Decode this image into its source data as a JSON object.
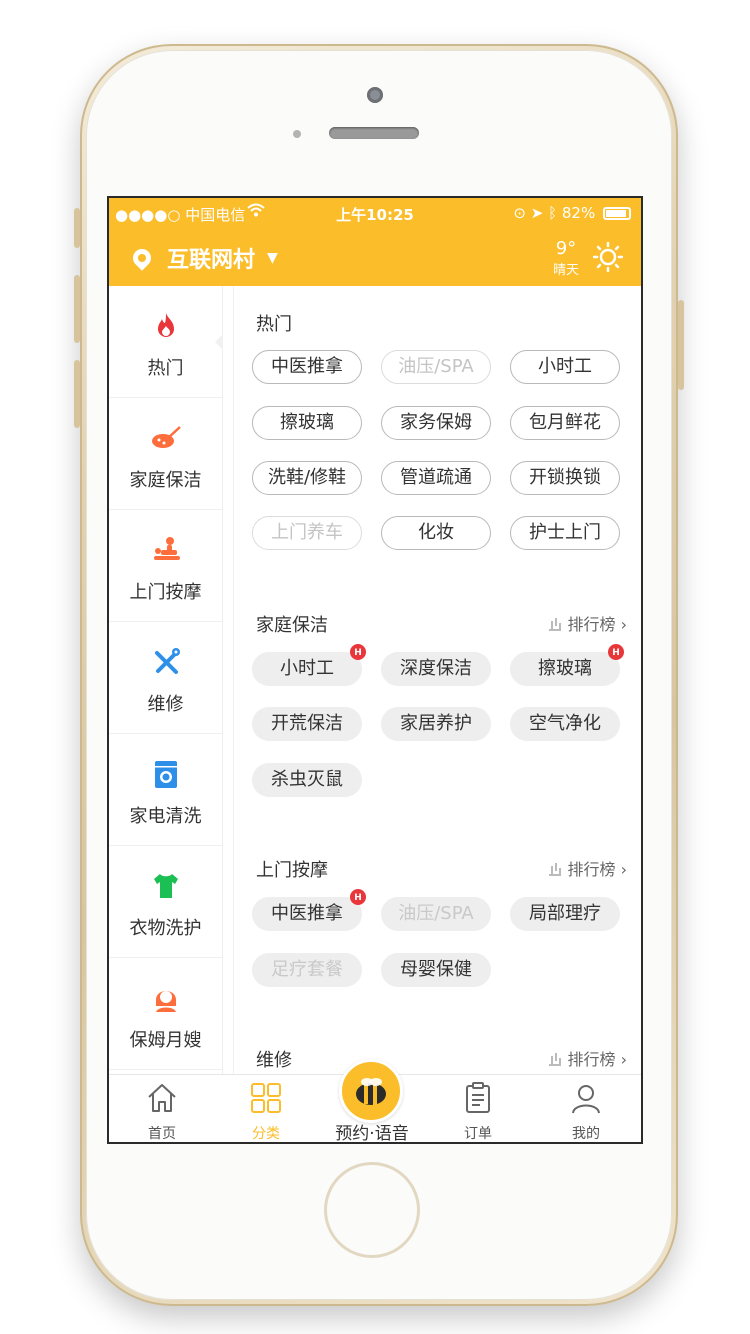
{
  "status": {
    "carrier": "●●●●○ 中国电信",
    "time": "上午10:25",
    "battery": "82%"
  },
  "header": {
    "location": "互联网村",
    "temperature": "9°",
    "weather": "晴天"
  },
  "nav": {
    "items": [
      {
        "label": "热门",
        "icon": "fire-icon"
      },
      {
        "label": "家庭保洁",
        "icon": "cleaning-icon"
      },
      {
        "label": "上门按摩",
        "icon": "massage-icon"
      },
      {
        "label": "维修",
        "icon": "repair-tools-icon"
      },
      {
        "label": "家电清洗",
        "icon": "washing-machine-icon"
      },
      {
        "label": "衣物洗护",
        "icon": "tshirt-icon"
      },
      {
        "label": "保姆月嫂",
        "icon": "nanny-icon"
      }
    ]
  },
  "sections": {
    "hot": {
      "title": "热门",
      "tags": [
        "中医推拿",
        "油压/SPA",
        "小时工",
        "擦玻璃",
        "家务保姆",
        "包月鲜花",
        "洗鞋/修鞋",
        "管道疏通",
        "开锁换锁",
        "上门养车",
        "化妆",
        "护士上门"
      ]
    },
    "cleaning": {
      "title": "家庭保洁",
      "rank": "排行榜",
      "tags": [
        "小时工",
        "深度保洁",
        "擦玻璃",
        "开荒保洁",
        "家居养护",
        "空气净化",
        "杀虫灭鼠"
      ]
    },
    "massage": {
      "title": "上门按摩",
      "rank": "排行榜",
      "tags": [
        "中医推拿",
        "油压/SPA",
        "局部理疗",
        "足疗套餐",
        "母婴保健"
      ]
    },
    "repair": {
      "title": "维修",
      "rank": "排行榜"
    },
    "hot_badge": "H"
  },
  "tabbar": {
    "home": "首页",
    "category": "分类",
    "center": "预约·语音",
    "orders": "订单",
    "mine": "我的"
  },
  "colors": {
    "accent": "#fbbd29",
    "hot_red": "#e9363b",
    "icon_orange": "#fd6e3c",
    "icon_blue": "#2e8fe8",
    "icon_green": "#1cbf53"
  }
}
